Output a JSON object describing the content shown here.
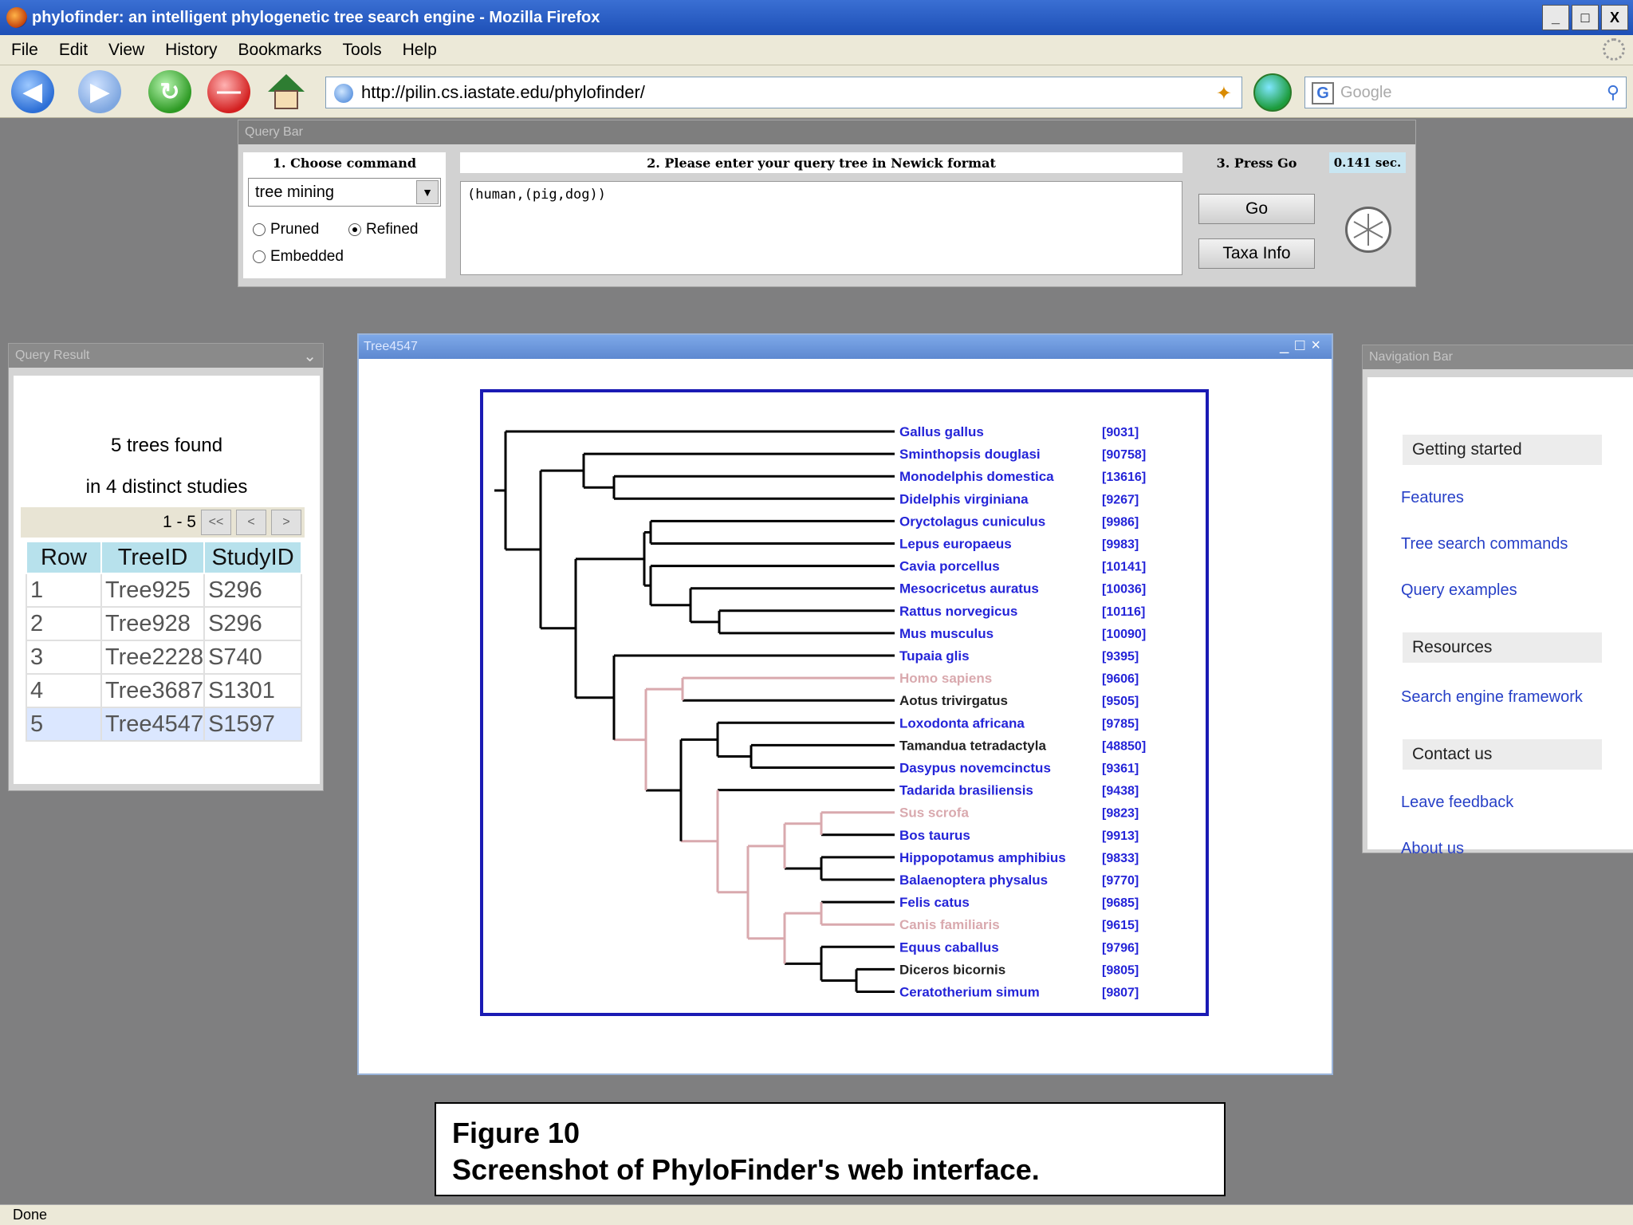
{
  "window": {
    "title": "phylofinder: an intelligent phylogenetic tree search engine - Mozilla Firefox",
    "minimize": "_",
    "maximize": "□",
    "close": "X"
  },
  "menu": [
    "File",
    "Edit",
    "View",
    "History",
    "Bookmarks",
    "Tools",
    "Help"
  ],
  "navigation": {
    "url": "http://pilin.cs.iastate.edu/phylofinder/",
    "search_placeholder": "Google"
  },
  "query_bar": {
    "panel_title": "Query Bar",
    "step1": "1. Choose command",
    "step2": "2. Please enter your query tree in Newick format",
    "step3": "3. Press Go",
    "elapsed": "0.141 sec.",
    "command": "tree mining",
    "options": [
      {
        "label": "Pruned",
        "checked": false
      },
      {
        "label": "Refined",
        "checked": true
      },
      {
        "label": "Embedded",
        "checked": false
      }
    ],
    "newick": "(human,(pig,dog))",
    "go_label": "Go",
    "taxa_label": "Taxa Info"
  },
  "query_result": {
    "panel_title": "Query Result",
    "found": "5 trees found",
    "studies": "in 4 distinct studies",
    "range": "1 - 5",
    "first": "<<",
    "prev": "<",
    "next": ">",
    "columns": [
      "Row",
      "TreeID",
      "StudyID"
    ],
    "rows": [
      [
        "1",
        "Tree925",
        "S296"
      ],
      [
        "2",
        "Tree928",
        "S296"
      ],
      [
        "3",
        "Tree2228",
        "S740"
      ],
      [
        "4",
        "Tree3687",
        "S1301"
      ],
      [
        "5",
        "Tree4547",
        "S1597"
      ]
    ],
    "selected_row": 5
  },
  "tree_window": {
    "title": "Tree4547",
    "taxa": [
      {
        "name": "Gallus gallus",
        "id": "[9031]",
        "color": "#2424d8"
      },
      {
        "name": "Sminthopsis douglasi",
        "id": "[90758]",
        "color": "#2424d8"
      },
      {
        "name": "Monodelphis domestica",
        "id": "[13616]",
        "color": "#2424d8"
      },
      {
        "name": "Didelphis virginiana",
        "id": "[9267]",
        "color": "#2424d8"
      },
      {
        "name": "Oryctolagus cuniculus",
        "id": "[9986]",
        "color": "#2424d8"
      },
      {
        "name": "Lepus europaeus",
        "id": "[9983]",
        "color": "#2424d8"
      },
      {
        "name": "Cavia porcellus",
        "id": "[10141]",
        "color": "#2424d8"
      },
      {
        "name": "Mesocricetus auratus",
        "id": "[10036]",
        "color": "#2424d8"
      },
      {
        "name": "Rattus norvegicus",
        "id": "[10116]",
        "color": "#2424d8"
      },
      {
        "name": "Mus musculus",
        "id": "[10090]",
        "color": "#2424d8"
      },
      {
        "name": "Tupaia glis",
        "id": "[9395]",
        "color": "#2424d8"
      },
      {
        "name": "Homo sapiens",
        "id": "[9606]",
        "color": "#d9a9ae"
      },
      {
        "name": "Aotus trivirgatus",
        "id": "[9505]",
        "color": "#222222"
      },
      {
        "name": "Loxodonta africana",
        "id": "[9785]",
        "color": "#2424d8"
      },
      {
        "name": "Tamandua tetradactyla",
        "id": "[48850]",
        "color": "#222222"
      },
      {
        "name": "Dasypus novemcinctus",
        "id": "[9361]",
        "color": "#2424d8"
      },
      {
        "name": "Tadarida brasiliensis",
        "id": "[9438]",
        "color": "#2424d8"
      },
      {
        "name": "Sus scrofa",
        "id": "[9823]",
        "color": "#d9a9ae"
      },
      {
        "name": "Bos taurus",
        "id": "[9913]",
        "color": "#2424d8"
      },
      {
        "name": "Hippopotamus amphibius",
        "id": "[9833]",
        "color": "#2424d8"
      },
      {
        "name": "Balaenoptera physalus",
        "id": "[9770]",
        "color": "#2424d8"
      },
      {
        "name": "Felis catus",
        "id": "[9685]",
        "color": "#2424d8"
      },
      {
        "name": "Canis familiaris",
        "id": "[9615]",
        "color": "#d9a9ae"
      },
      {
        "name": "Equus caballus",
        "id": "[9796]",
        "color": "#2424d8"
      },
      {
        "name": "Diceros bicornis",
        "id": "[9805]",
        "color": "#222222"
      },
      {
        "name": "Ceratotherium simum",
        "id": "[9807]",
        "color": "#2424d8"
      }
    ]
  },
  "navigation_bar": {
    "panel_title": "Navigation Bar",
    "sections": [
      {
        "heading": "Getting started",
        "links": [
          "Features",
          "Tree search commands",
          "Query examples"
        ]
      },
      {
        "heading": "Resources",
        "links": [
          "Search engine framework"
        ]
      },
      {
        "heading": "Contact us",
        "links": [
          "Leave feedback",
          "About us"
        ]
      }
    ]
  },
  "caption": {
    "line1": "Figure 10",
    "line2": "Screenshot of PhyloFinder's web interface."
  },
  "status": "Done",
  "colors": {
    "highlight": "#d9a9ae",
    "link": "#2424d8",
    "frame": "#1a1ab4"
  }
}
